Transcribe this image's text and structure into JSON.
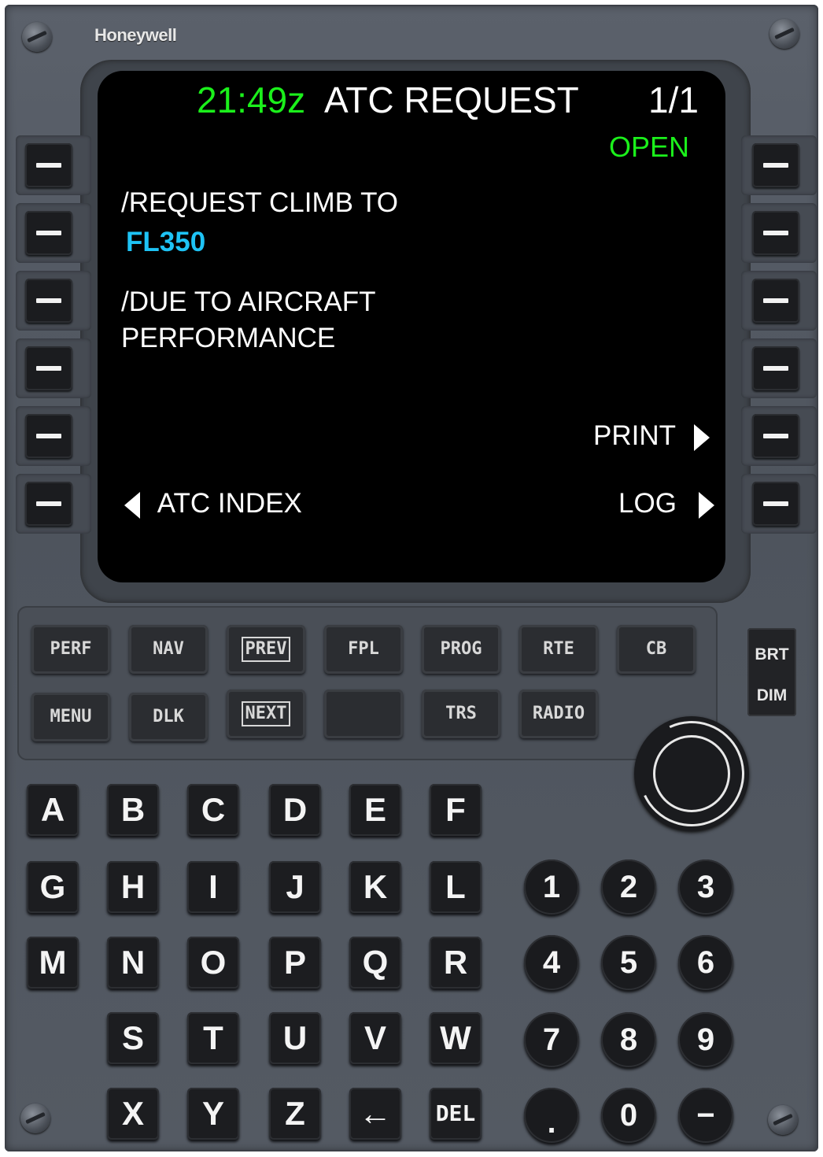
{
  "brand": "Honeywell",
  "screen": {
    "time": "21:49z",
    "title": "ATC REQUEST",
    "page": "1/1",
    "status": "OPEN",
    "line1_label": "/REQUEST CLIMB TO",
    "line1_value": "FL350",
    "line2_label": "/DUE TO AIRCRAFT",
    "line2_value": "PERFORMANCE",
    "print": "PRINT",
    "atc_index": "ATC INDEX",
    "log": "LOG"
  },
  "function_keys_row1": [
    "PERF",
    "NAV",
    "PREV",
    "FPL",
    "PROG",
    "RTE",
    "CB"
  ],
  "function_keys_row2": [
    "MENU",
    "DLK",
    "NEXT",
    "",
    "TRS",
    "RADIO"
  ],
  "brightness": {
    "brt": "BRT",
    "dim": "DIM"
  },
  "alpha_keys": [
    "A",
    "B",
    "C",
    "D",
    "E",
    "F",
    "G",
    "H",
    "I",
    "J",
    "K",
    "L",
    "M",
    "N",
    "O",
    "P",
    "Q",
    "R",
    "S",
    "T",
    "U",
    "V",
    "W",
    "X",
    "Y",
    "Z",
    "←",
    "DEL"
  ],
  "numeric_keys": [
    "1",
    "2",
    "3",
    "4",
    "5",
    "6",
    "7",
    "8",
    "9",
    ".",
    "0",
    "−"
  ],
  "colors": {
    "green": "#1bf01b",
    "cyan": "#1ec3f5",
    "white": "#ffffff"
  }
}
